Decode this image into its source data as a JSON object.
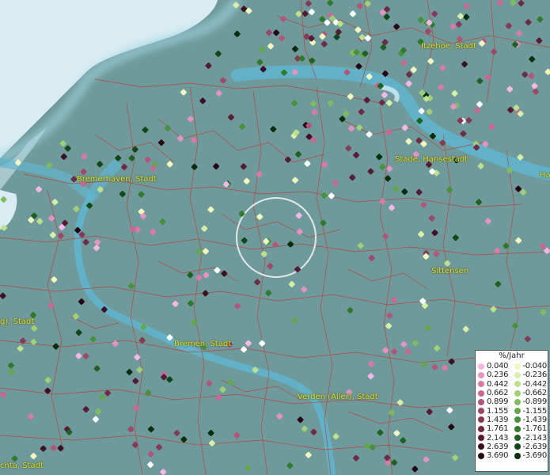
{
  "map": {
    "city_labels": [
      {
        "id": "itzehoe",
        "text": "Itzehoe, Stadt"
      },
      {
        "id": "stade",
        "text": "Stade, Hansestadt"
      },
      {
        "id": "bremerhaven",
        "text": "Bremerhaven, Stadt"
      },
      {
        "id": "sittensen",
        "text": "Sittensen"
      },
      {
        "id": "bremen",
        "text": "Bremen, Stadt"
      },
      {
        "id": "verden",
        "text": "Verden (Aller), Stadt"
      },
      {
        "id": "vechta",
        "text": "chta, Stadt"
      },
      {
        "id": "oldenburg",
        "text": "g), Stadt"
      },
      {
        "id": "hamburg",
        "text": "Ha"
      }
    ],
    "colors": {
      "land": "#6f9a9b",
      "sea": "#d8ecf2",
      "river": "#5fb5d0",
      "boundaries": "#c0392b",
      "label": "#e8e020"
    }
  },
  "legend": {
    "title": "%/Jahr",
    "positive": [
      {
        "value": "0.040",
        "color": "#f5b8e6"
      },
      {
        "value": "0.236",
        "color": "#e493c4"
      },
      {
        "value": "0.442",
        "color": "#d97aa8"
      },
      {
        "value": "0.662",
        "color": "#c96891"
      },
      {
        "value": "0.899",
        "color": "#b2557a"
      },
      {
        "value": "1.155",
        "color": "#9c4866"
      },
      {
        "value": "1.439",
        "color": "#853a55"
      },
      {
        "value": "1.761",
        "color": "#6e2b44"
      },
      {
        "value": "2.143",
        "color": "#561c33"
      },
      {
        "value": "2.639",
        "color": "#3e1024"
      },
      {
        "value": "3.690",
        "color": "#260612"
      }
    ],
    "negative": [
      {
        "value": "-0.040",
        "color": "#f2f7c0"
      },
      {
        "value": "-0.236",
        "color": "#d9eea6"
      },
      {
        "value": "-0.442",
        "color": "#bde08d"
      },
      {
        "value": "-0.662",
        "color": "#a0cf76"
      },
      {
        "value": "-0.899",
        "color": "#80bb5f"
      },
      {
        "value": "-1.155",
        "color": "#62a74b"
      },
      {
        "value": "-1.439",
        "color": "#46913a"
      },
      {
        "value": "-1.761",
        "color": "#2f7a2c"
      },
      {
        "value": "-2.143",
        "color": "#1d6220"
      },
      {
        "value": "-2.639",
        "color": "#0f4816"
      },
      {
        "value": "-3.690",
        "color": "#062d0c"
      }
    ]
  }
}
